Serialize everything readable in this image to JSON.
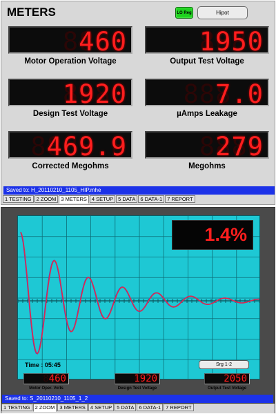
{
  "header": {
    "title": "METERS",
    "lo_reg_label": "LO Reg",
    "hipot_label": "Hipot"
  },
  "meters": [
    {
      "label": "Motor Operation Voltage",
      "value": "460",
      "ghost": "8888"
    },
    {
      "label": "Output Test Voltage",
      "value": "1950",
      "ghost": "8888"
    },
    {
      "label": "Design Test Voltage",
      "value": "1920",
      "ghost": "8888"
    },
    {
      "label": "µAmps Leakage",
      "value": "7.0",
      "ghost": "888.8"
    },
    {
      "label": "Corrected Megohms",
      "value": "469.9",
      "ghost": "8888.8"
    },
    {
      "label": "Megohms",
      "value": "279",
      "ghost": "8888"
    }
  ],
  "status_top": "Saved to: H_20110210_1105_HIP.mhe",
  "tabs_top": [
    "1 TESTING",
    "2 ZOOM",
    "3 METERS",
    "4 SETUP",
    "5 DATA",
    "6 DATA-1",
    "7 REPORT"
  ],
  "tabs_top_active": "3 METERS",
  "scope": {
    "percent": "1.4%",
    "time_label": "Time : 05:45",
    "srg_label": "Srg 1-2",
    "colors": {
      "background": "#1ec8d4",
      "trace_red": "#e0294a",
      "trace_blue": "#4a3fd0",
      "grid": "#0d6d78"
    },
    "waveform": {
      "amplitude": 0.95,
      "decay": 0.0082,
      "period": 0.15,
      "points": 200
    }
  },
  "mini_meters": [
    {
      "label": "Motor Oper. Volts",
      "value": "460",
      "ghost": "8888"
    },
    {
      "label": "Design Test Voltage",
      "value": "1920",
      "ghost": "8888"
    },
    {
      "label": "Output Test Voltage",
      "value": "2050",
      "ghost": "8888"
    }
  ],
  "status_bottom": "Saved to: S_20110210_1105_1_2",
  "tabs_bottom": [
    "1 TESTING",
    "2 ZOOM",
    "3 METERS",
    "4 SETUP",
    "5 DATA",
    "6 DATA-1",
    "7 REPORT"
  ],
  "tabs_bottom_active": "2 ZOOM"
}
